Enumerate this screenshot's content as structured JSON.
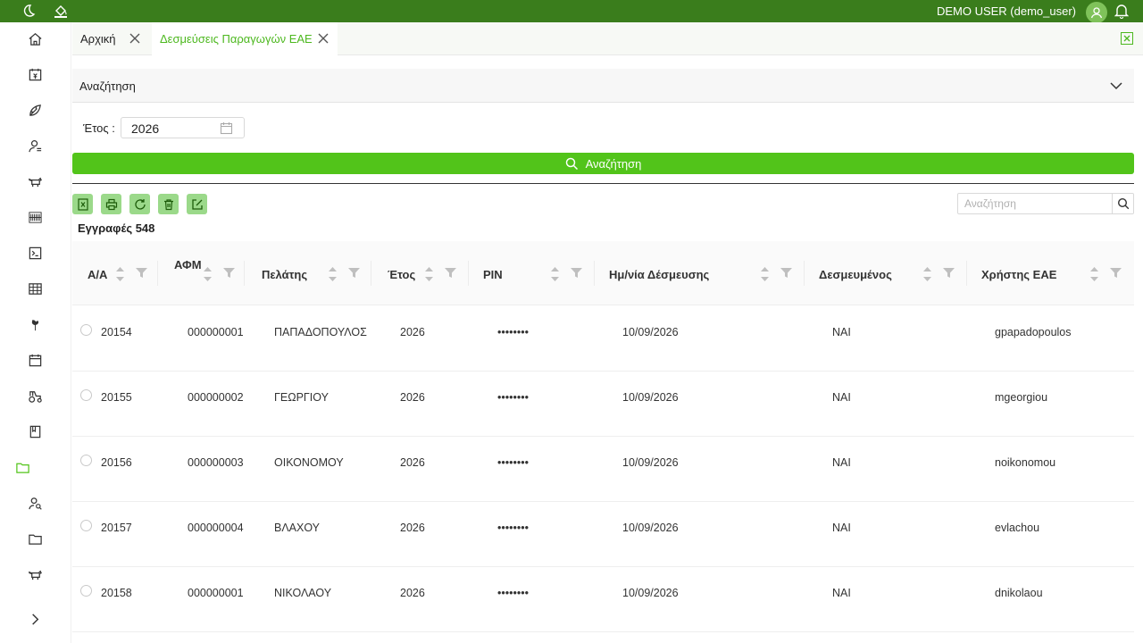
{
  "topbar": {
    "user": "DEMO USER (demo_user)",
    "icons": [
      "moon-icon",
      "paint-bucket-icon",
      "user-avatar-icon",
      "bell-icon"
    ]
  },
  "sidebar": {
    "icons": [
      "home-icon",
      "calendar-money-icon",
      "leaf-icon",
      "user-list-icon",
      "cow-icon",
      "barcode-icon",
      "terminal-icon",
      "table-icon",
      "tree-icon",
      "calendar-icon",
      "tractor-icon",
      "book-icon",
      "folder-icon",
      "user-search-icon",
      "folder-icon",
      "cow-icon",
      "expand-icon"
    ],
    "active_index": 12
  },
  "tabs": [
    {
      "label": "Αρχική",
      "active": false
    },
    {
      "label": "Δεσμεύσεις Παραγωγών ΕΑΕ",
      "active": true
    }
  ],
  "search_panel": {
    "title": "Αναζήτηση"
  },
  "filters": {
    "year_label": "Έτος :",
    "year_value": "2026"
  },
  "search_button": {
    "label": "Αναζήτηση"
  },
  "toolbar": {
    "buttons": [
      "excel-export-icon",
      "print-icon",
      "refresh-icon",
      "delete-icon",
      "edit-icon"
    ]
  },
  "table_search": {
    "placeholder": "Αναζήτηση"
  },
  "records": {
    "label": "Εγγραφές 548"
  },
  "table": {
    "columns": [
      "Α/Α",
      "ΑΦΜ",
      "Πελάτης",
      "Έτος",
      "PIN",
      "Ημ/νία Δέσμευσης",
      "Δεσμευμένος",
      "Χρήστης ΕΑΕ"
    ],
    "rows": [
      {
        "aa": "20154",
        "afm": "000000001",
        "client": "ΠΑΠΑΔΟΠΟΥΛΟΣ",
        "year": "2026",
        "pin": "••••••••",
        "date": "10/09/2026",
        "reserved": "ΝΑΙ",
        "user": "gpapadopoulos"
      },
      {
        "aa": "20155",
        "afm": "000000002",
        "client": "ΓΕΩΡΓΙΟΥ",
        "year": "2026",
        "pin": "••••••••",
        "date": "10/09/2026",
        "reserved": "ΝΑΙ",
        "user": "mgeorgiou"
      },
      {
        "aa": "20156",
        "afm": "000000003",
        "client": "ΟΙΚΟΝΟΜΟΥ",
        "year": "2026",
        "pin": "••••••••",
        "date": "10/09/2026",
        "reserved": "ΝΑΙ",
        "user": "noikonomou"
      },
      {
        "aa": "20157",
        "afm": "000000004",
        "client": "ΒΛΑΧΟΥ",
        "year": "2026",
        "pin": "••••••••",
        "date": "10/09/2026",
        "reserved": "ΝΑΙ",
        "user": "evlachou"
      },
      {
        "aa": "20158",
        "afm": "000000001",
        "client": "ΝΙΚΟΛΑΟΥ",
        "year": "2026",
        "pin": "••••••••",
        "date": "10/09/2026",
        "reserved": "ΝΑΙ",
        "user": "dnikolaou"
      }
    ]
  },
  "colors": {
    "topbar": "#3a7d1c",
    "accent": "#52c41a",
    "tool_button": "#9bd98a"
  }
}
